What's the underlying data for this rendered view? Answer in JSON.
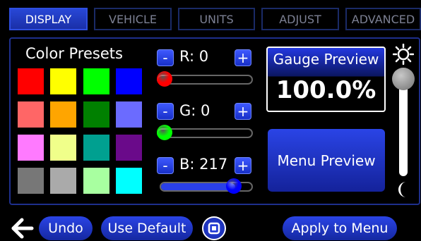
{
  "tabs": [
    {
      "label": "DISPLAY",
      "active": true
    },
    {
      "label": "VEHICLE",
      "active": false
    },
    {
      "label": "UNITS",
      "active": false
    },
    {
      "label": "ADJUST",
      "active": false
    },
    {
      "label": "ADVANCED",
      "active": false
    }
  ],
  "color_presets": {
    "title": "Color Presets",
    "swatches": [
      "#ff0000",
      "#ffff00",
      "#00ff00",
      "#0000ff",
      "#ff6666",
      "#ffa500",
      "#008000",
      "#6b6bff",
      "#ff7aff",
      "#f0ff8a",
      "#00a090",
      "#6a0a8a",
      "#777777",
      "#aaaaaa",
      "#a8ffa0",
      "#00ffff"
    ]
  },
  "channels": [
    {
      "label": "R: 0",
      "value": 0,
      "color": "#ff0000"
    },
    {
      "label": "G: 0",
      "value": 0,
      "color": "#00ff00"
    },
    {
      "label": "B: 217",
      "value": 217,
      "color": "#0000ff"
    }
  ],
  "stepper": {
    "minus": "-",
    "plus": "+"
  },
  "gauge_preview": {
    "title": "Gauge Preview",
    "value": "100.0%"
  },
  "menu_preview": {
    "label": "Menu Preview"
  },
  "brightness": {
    "level": 1.0,
    "sun_icon": "sun-icon",
    "moon_icon": "moon-icon"
  },
  "bottom_bar": {
    "back_icon": "back-arrow-icon",
    "undo": "Undo",
    "use_default": "Use Default",
    "home_icon": "home-button-icon",
    "apply": "Apply to Menu"
  },
  "colors": {
    "accent": "#2340e0",
    "border": "#1e2f8c",
    "text": "#ffffff"
  }
}
